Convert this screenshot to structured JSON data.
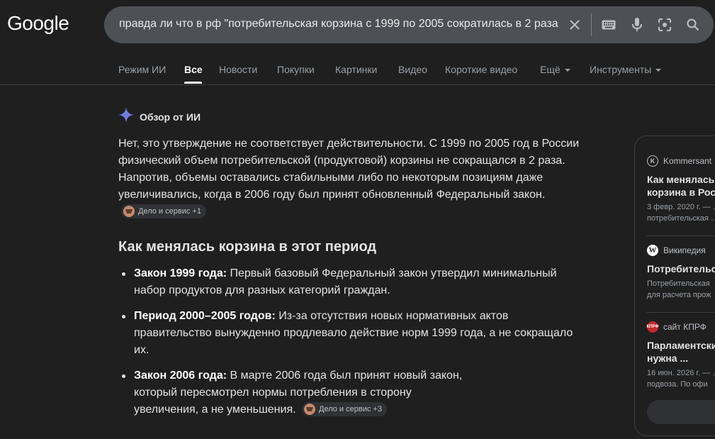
{
  "header": {
    "logo": "Google",
    "search_query": "правда ли что в рф \"потребительская корзина с 1999 по 2005 сократилась в 2 раза",
    "icons": [
      "close-icon",
      "keyboard-icon",
      "microphone-icon",
      "lens-icon",
      "search-icon"
    ]
  },
  "tabs": [
    {
      "label": "Режим ИИ"
    },
    {
      "label": "Все"
    },
    {
      "label": "Новости"
    },
    {
      "label": "Покупки"
    },
    {
      "label": "Картинки"
    },
    {
      "label": "Видео"
    },
    {
      "label": "Короткие видео"
    },
    {
      "label": "Ещё"
    },
    {
      "label": "Инструменты"
    }
  ],
  "ai_overview": {
    "label": "Обзор от ИИ",
    "paragraph": "Нет, это утверждение не соответствует действительности. С 1999 по 2005 год в России физический объем потребительской (продуктовой) корзины не сокращался в 2 раза. Напротив, объемы оставались стабильными либо по некоторым позициям даже увеличивались, когда в 2006 году был принят обновленный Федеральный закон.",
    "paragraph_chip": "Дело и сервис +1",
    "heading": "Как менялась корзина в этот период",
    "bullets": [
      {
        "bold": "Закон 1999 года:",
        "text": " Первый базовый Федеральный закон утвердил минимальный набор продуктов для разных категорий граждан."
      },
      {
        "bold": "Период 2000–2005 годов:",
        "text": " Из-за отсутствия новых нормативных актов правительство вынужденно продлевало действие норм 1999 года, а не сокращало их."
      },
      {
        "bold": "Закон 2006 года:",
        "text": " В марте 2006 года был принят новый закон, который пересмотрел нормы потребления в сторону увеличения, а не уменьшения.",
        "chip": "Дело и сервис +3"
      }
    ]
  },
  "sources": [
    {
      "site": "Kommersant",
      "title": "Как менялась\nкорзина в Росс",
      "snippet": "3 февр. 2020 г. — …\nпотребительская …"
    },
    {
      "site": "Википедия",
      "title": "Потребительс",
      "snippet": "Потребительская\nдля расчета прож"
    },
    {
      "site": "сайт КПРФ",
      "title": "Парламентски\nнужна ...",
      "snippet": "16 июн. 2026 г. — …\nподвоза. По офи"
    }
  ]
}
